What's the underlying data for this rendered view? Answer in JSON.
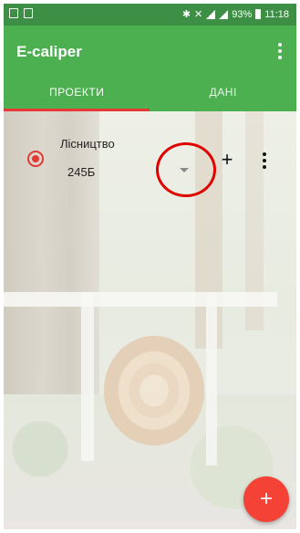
{
  "status_bar": {
    "battery": "93%",
    "time": "11:18"
  },
  "app_bar": {
    "title": "E-caliper"
  },
  "tabs": [
    {
      "label": "ПРОЕКТИ",
      "active": true
    },
    {
      "label": "ДАНІ",
      "active": false
    }
  ],
  "project_row": {
    "name": "Лісництво",
    "selected_value": "245Б",
    "add_symbol": "+"
  },
  "fab": {
    "symbol": "+"
  },
  "colors": {
    "primary": "#4caf50",
    "status_bar": "#3c8f44",
    "accent": "#e53935",
    "fab": "#f44336",
    "highlight": "#e00000"
  },
  "icons": {
    "overflow": "more-vert-icon",
    "dropdown": "arrow-drop-down-icon",
    "add": "plus-icon",
    "radio": "radio-checked-icon"
  }
}
